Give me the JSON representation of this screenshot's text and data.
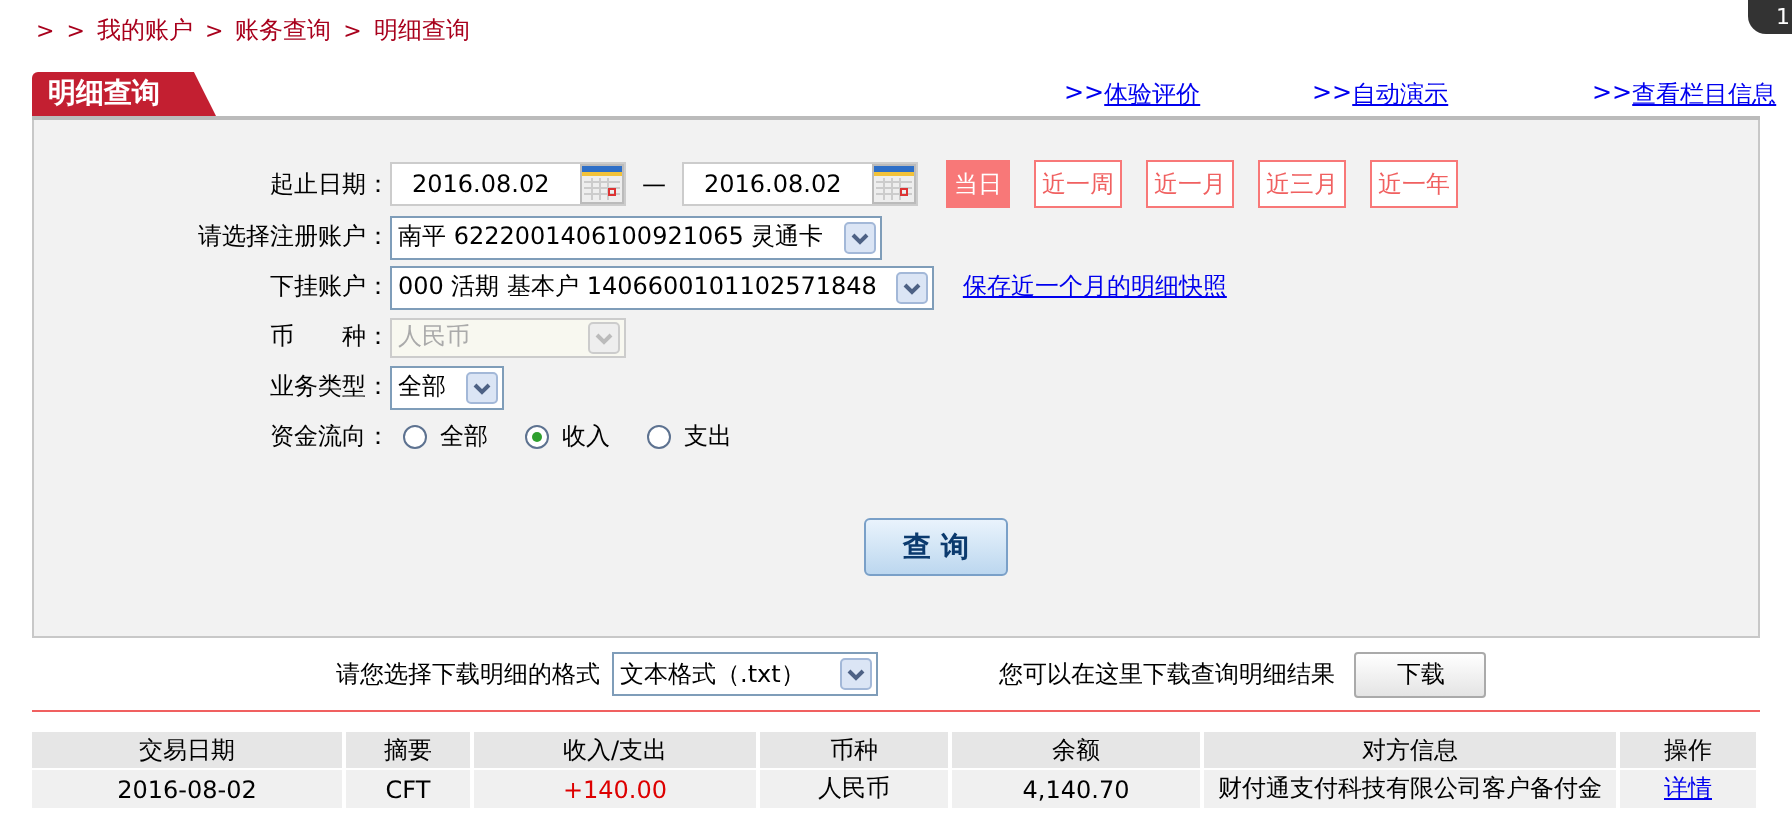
{
  "breadcrumb": [
    {
      "kind": "separator",
      "text": ">"
    },
    {
      "kind": "separator",
      "text": ">"
    },
    {
      "kind": "link",
      "text": "我的账户"
    },
    {
      "kind": "separator",
      "text": ">"
    },
    {
      "kind": "link",
      "text": "账务查询"
    },
    {
      "kind": "separator",
      "text": ">"
    },
    {
      "kind": "link",
      "text": "明细查询"
    }
  ],
  "notification_badge": {
    "count": "1"
  },
  "section_tab": {
    "title": "明细查询"
  },
  "header_links": [
    {
      "prefix": ">>",
      "text": "体验评价"
    },
    {
      "prefix": ">>",
      "text": "自动演示"
    },
    {
      "prefix": ">>",
      "text": "查看栏目信息"
    }
  ],
  "form": [
    {
      "kind": "daterange",
      "label": "起止日期：",
      "start": "2016.08.02",
      "separator": "—",
      "end": "2016.08.02",
      "quick": [
        {
          "text": "当日",
          "selected": true
        },
        {
          "text": "近一周",
          "selected": false
        },
        {
          "text": "近一月",
          "selected": false
        },
        {
          "text": "近三月",
          "selected": false
        },
        {
          "text": "近一年",
          "selected": false
        }
      ]
    },
    {
      "kind": "select",
      "label": "请选择注册账户：",
      "value": "南平 6222001406100921065 灵通卡",
      "disabled": false
    },
    {
      "kind": "select",
      "label": "下挂账户：",
      "value": "000 活期 基本户 1406600101102571848",
      "disabled": false,
      "link": "保存近一个月的明细快照"
    },
    {
      "kind": "select",
      "label": "币　　种：",
      "value": "人民币",
      "disabled": true
    },
    {
      "kind": "select",
      "label": "业务类型：",
      "value": "全部",
      "disabled": false
    },
    {
      "kind": "radio",
      "label": "资金流向：",
      "options": [
        {
          "text": "全部",
          "selected": false
        },
        {
          "text": "收入",
          "selected": true
        },
        {
          "text": "支出",
          "selected": false
        }
      ]
    }
  ],
  "query_button": "查 询",
  "download": {
    "prompt": "请您选择下载明细的格式",
    "format": "文本格式（.txt）",
    "hint": "您可以在这里下载查询明细结果",
    "button": "下载"
  },
  "table": {
    "columns": [
      "交易日期",
      "摘要",
      "收入/支出",
      "币种",
      "余额",
      "对方信息",
      "操作"
    ],
    "rows": [
      {
        "date": "2016-08-02",
        "summary": "CFT",
        "amount": "+140.00",
        "currency": "人民币",
        "balance": "4,140.70",
        "counterparty": "财付通支付科技有限公司客户备付金",
        "action": "详情"
      }
    ]
  }
}
